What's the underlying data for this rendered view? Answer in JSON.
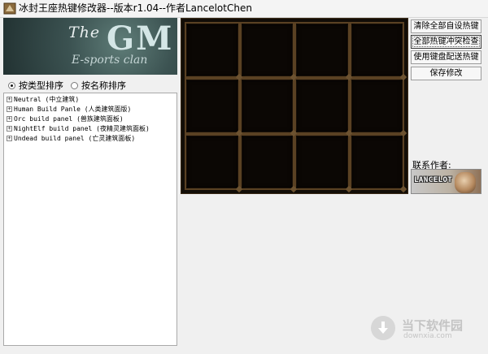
{
  "window": {
    "title": "冰封王座热键修改器--版本r1.04--作者LancelotChen"
  },
  "logo": {
    "the": "The",
    "gm": "GM",
    "sub": "E-sports clan"
  },
  "sort_options": [
    {
      "label": "按类型排序",
      "selected": true
    },
    {
      "label": "按名称排序",
      "selected": false
    }
  ],
  "tree": {
    "expander": "+",
    "items": [
      {
        "label": "Neutral (中立建筑)"
      },
      {
        "label": "Human Build Panle (人类建筑面版)"
      },
      {
        "label": "Orc build panel (兽族建筑面板)"
      },
      {
        "label": "NightElf build panel (夜精灵建筑面板)"
      },
      {
        "label": "Undead build panel (亡灵建筑面板)"
      }
    ]
  },
  "buttons": {
    "clear_hotkeys": "清除全部自设热键",
    "check_conflicts": "全部热键冲突检查",
    "keyboard_layout": "使用键盘配送热键",
    "save": "保存修改"
  },
  "contact": {
    "label": "联系作者:",
    "avatar_name": "LANCELOT"
  },
  "watermark": {
    "title": "当下软件园",
    "url": "downxia.com"
  },
  "colors": {
    "grid_background": "#120d07",
    "grid_border": "#5a4123",
    "logo_bg": "#3c5352"
  }
}
